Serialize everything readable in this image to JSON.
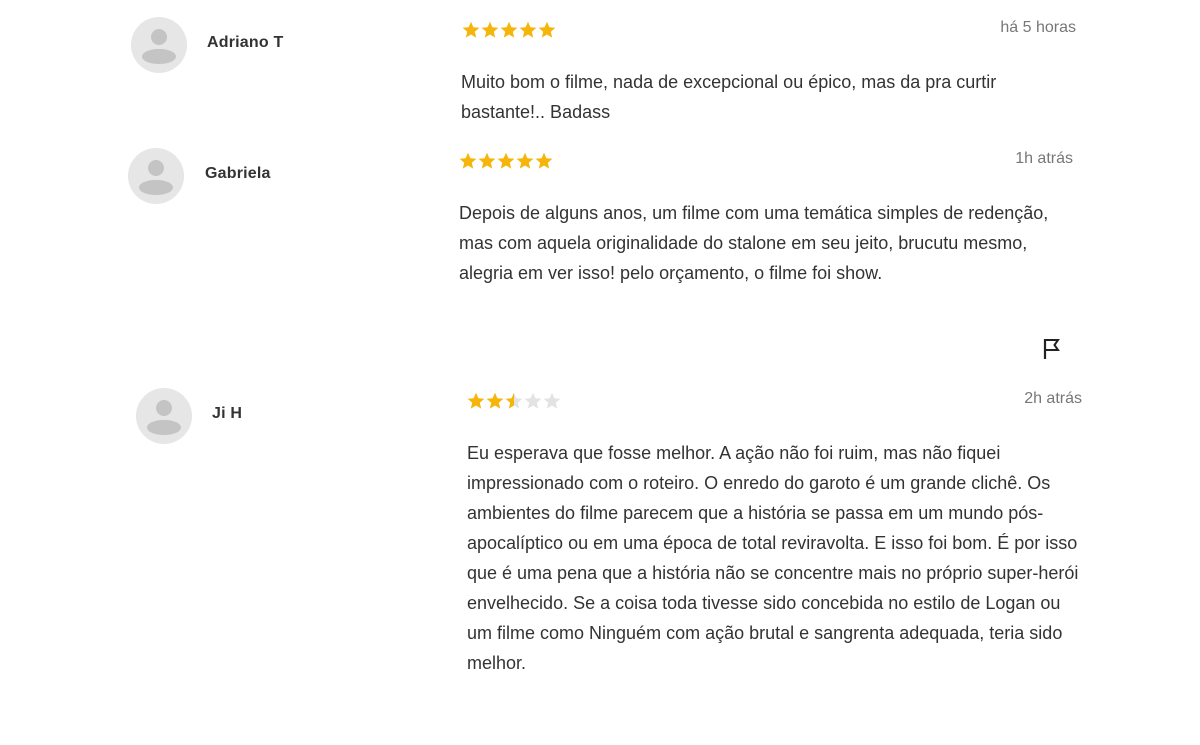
{
  "reviews": [
    {
      "author": "Adriano T",
      "rating": 5,
      "time": "há 5 horas",
      "text": "Muito bom o filme, nada de excepcional ou épico, mas da pra curtir bastante!.. Badass"
    },
    {
      "author": "Gabriela",
      "rating": 5,
      "time": "1h atrás",
      "text": "Depois de alguns anos, um filme com uma temática simples de redenção, mas com aquela originalidade do stalone em seu jeito, brucutu mesmo, alegria em ver isso! pelo orçamento, o filme foi show."
    },
    {
      "author": "Ji H",
      "rating": 2.5,
      "time": "2h atrás",
      "text": "Eu esperava que fosse melhor. A ação não foi ruim, mas não fiquei impressionado com o roteiro. O enredo do garoto é um grande clichê. Os ambientes do filme parecem que a história se passa em um mundo pós-apocalíptico ou em uma época de total reviravolta. E isso foi bom. É por isso que é uma pena que a história não se concentre mais no próprio super-herói envelhecido. Se a coisa toda tivesse sido concebida no estilo de Logan ou um filme como Ninguém com ação brutal e sangrenta adequada, teria sido melhor."
    }
  ],
  "icons": {
    "avatar": "user-avatar-icon",
    "star": "star-icon",
    "flag": "flag-icon"
  },
  "colors": {
    "star_filled": "#f5b50a",
    "star_empty": "#e3e3e3",
    "time": "#777777",
    "text": "#333333"
  }
}
